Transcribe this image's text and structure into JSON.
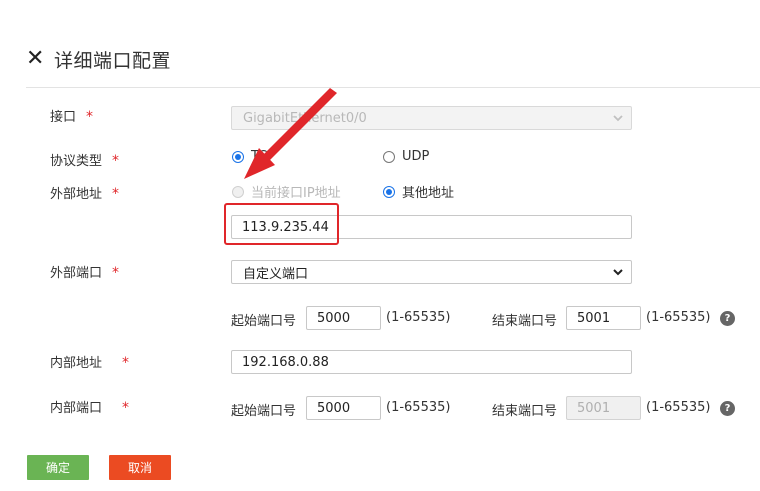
{
  "header": {
    "close_icon": "close-icon",
    "title": "详细端口配置"
  },
  "required_mark": "*",
  "form": {
    "interface": {
      "label": "接口",
      "value": "GigabitEthernet0/0",
      "disabled": true
    },
    "protocol": {
      "label": "协议类型",
      "options": [
        {
          "label": "TCP",
          "selected": true
        },
        {
          "label": "UDP",
          "selected": false
        }
      ]
    },
    "external_address": {
      "label": "外部地址",
      "options": [
        {
          "label": "当前接口IP地址",
          "selected": false,
          "disabled": true
        },
        {
          "label": "其他地址",
          "selected": true
        }
      ],
      "value": "113.9.235.44"
    },
    "external_port": {
      "label": "外部端口",
      "mode": "自定义端口",
      "start_label": "起始端口号",
      "start_value": "5000",
      "range": "(1-65535)",
      "end_label": "结束端口号",
      "end_value": "5001"
    },
    "internal_address": {
      "label": "内部地址",
      "value": "192.168.0.88"
    },
    "internal_port": {
      "label": "内部端口",
      "start_label": "起始端口号",
      "start_value": "5000",
      "range": "(1-65535)",
      "end_label": "结束端口号",
      "end_value": "5001",
      "end_disabled": true
    }
  },
  "help_icon": "?",
  "buttons": {
    "ok": "确定",
    "cancel": "取消"
  },
  "annotation": {
    "highlight_color": "#e0262a"
  }
}
